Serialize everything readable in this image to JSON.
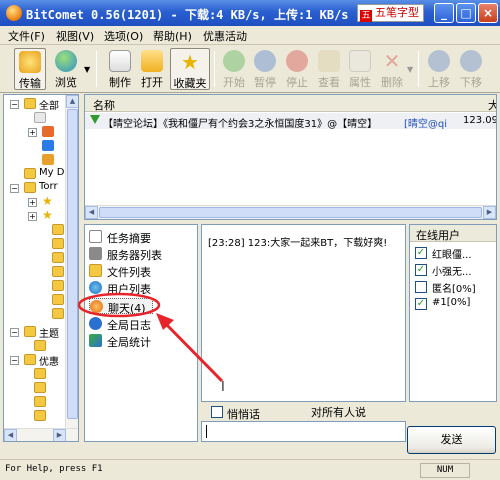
{
  "window": {
    "title": "BitComet 0.56(1201) - 下载:4 KB/s, 上传:1 KB/s",
    "ime_label": "五笔字型",
    "buttons": {
      "minimize": "_",
      "maximize": "□",
      "close": "×"
    }
  },
  "menu": [
    "文件(F)",
    "视图(V)",
    "选项(O)",
    "帮助(H)",
    "优惠活动"
  ],
  "toolbar": {
    "transfer": "传输",
    "browse": "浏览",
    "make": "制作",
    "open": "打开",
    "favorites": "收藏夹",
    "start": "开始",
    "pause": "暂停",
    "stop": "停止",
    "view": "查看",
    "properties": "属性",
    "delete": "删除",
    "move_up": "上移",
    "move_down": "下移"
  },
  "tree": {
    "items": [
      "全部",
      "My D",
      "Torr",
      "主题",
      "优惠"
    ]
  },
  "download_list": {
    "col_name": "名称",
    "col_extra": "大",
    "row": {
      "name": "【晴空论坛】《我和僵尸有个约会3之永恒国度31》@【晴空】",
      "tracker": "[晴空@qi",
      "size": "123.09"
    }
  },
  "nav": {
    "items": [
      "任务摘要",
      "服务器列表",
      "文件列表",
      "用户列表",
      "聊天(4)",
      "全局日志",
      "全局统计"
    ],
    "selected_index": 4
  },
  "chat": {
    "message": "[23:28] 123:大家一起来BT，下载好爽!"
  },
  "users": {
    "header": "在线用户",
    "list": [
      "红眼僵...",
      "小强无...",
      "匿名[0%]",
      "#1[0%]"
    ],
    "checked": [
      true,
      true,
      false,
      true
    ]
  },
  "whisper": {
    "label": "悄悄话",
    "target": "对所有人说"
  },
  "send_label": "发送",
  "status": {
    "text": "For Help, press F1",
    "num": "NUM"
  },
  "colors": {
    "titlebar": "#2A5FD0",
    "annotation_arrow": "#E8232A",
    "download_arrow": "#2E9B2E"
  }
}
